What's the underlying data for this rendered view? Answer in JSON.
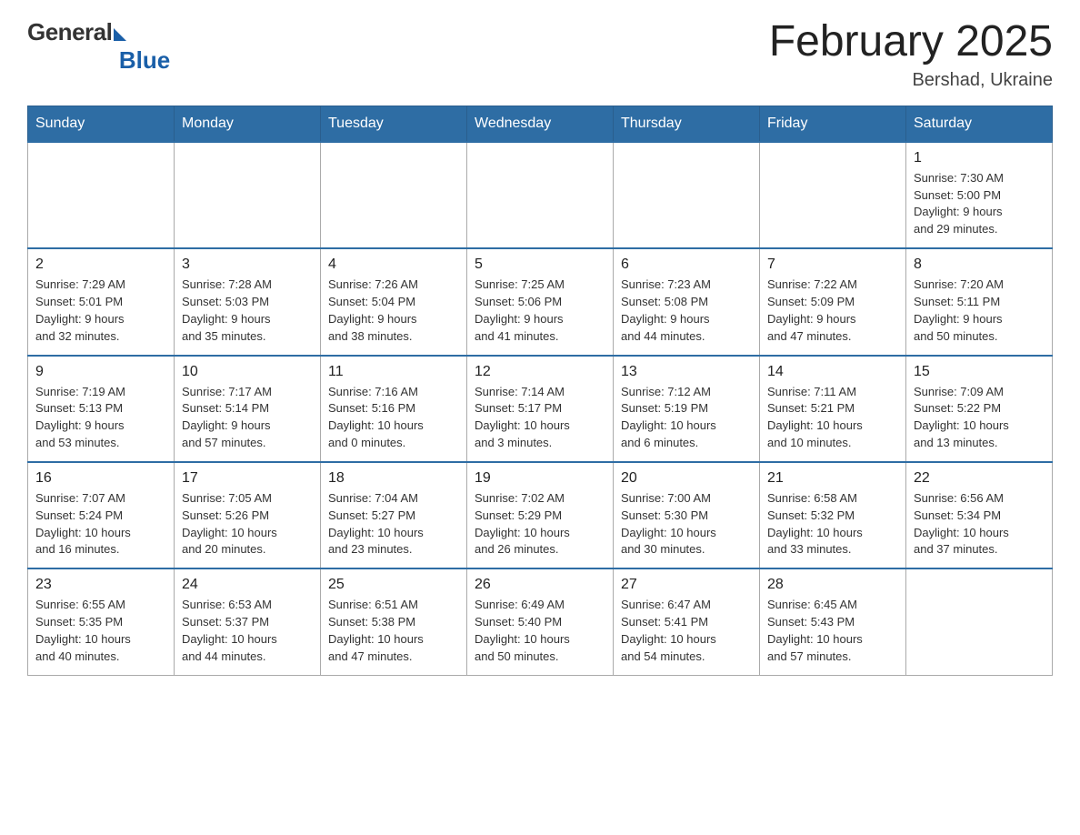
{
  "logo": {
    "general": "General",
    "blue": "Blue"
  },
  "header": {
    "title": "February 2025",
    "location": "Bershad, Ukraine"
  },
  "days_of_week": [
    "Sunday",
    "Monday",
    "Tuesday",
    "Wednesday",
    "Thursday",
    "Friday",
    "Saturday"
  ],
  "weeks": [
    {
      "days": [
        {
          "num": "",
          "info": ""
        },
        {
          "num": "",
          "info": ""
        },
        {
          "num": "",
          "info": ""
        },
        {
          "num": "",
          "info": ""
        },
        {
          "num": "",
          "info": ""
        },
        {
          "num": "",
          "info": ""
        },
        {
          "num": "1",
          "info": "Sunrise: 7:30 AM\nSunset: 5:00 PM\nDaylight: 9 hours\nand 29 minutes."
        }
      ]
    },
    {
      "days": [
        {
          "num": "2",
          "info": "Sunrise: 7:29 AM\nSunset: 5:01 PM\nDaylight: 9 hours\nand 32 minutes."
        },
        {
          "num": "3",
          "info": "Sunrise: 7:28 AM\nSunset: 5:03 PM\nDaylight: 9 hours\nand 35 minutes."
        },
        {
          "num": "4",
          "info": "Sunrise: 7:26 AM\nSunset: 5:04 PM\nDaylight: 9 hours\nand 38 minutes."
        },
        {
          "num": "5",
          "info": "Sunrise: 7:25 AM\nSunset: 5:06 PM\nDaylight: 9 hours\nand 41 minutes."
        },
        {
          "num": "6",
          "info": "Sunrise: 7:23 AM\nSunset: 5:08 PM\nDaylight: 9 hours\nand 44 minutes."
        },
        {
          "num": "7",
          "info": "Sunrise: 7:22 AM\nSunset: 5:09 PM\nDaylight: 9 hours\nand 47 minutes."
        },
        {
          "num": "8",
          "info": "Sunrise: 7:20 AM\nSunset: 5:11 PM\nDaylight: 9 hours\nand 50 minutes."
        }
      ]
    },
    {
      "days": [
        {
          "num": "9",
          "info": "Sunrise: 7:19 AM\nSunset: 5:13 PM\nDaylight: 9 hours\nand 53 minutes."
        },
        {
          "num": "10",
          "info": "Sunrise: 7:17 AM\nSunset: 5:14 PM\nDaylight: 9 hours\nand 57 minutes."
        },
        {
          "num": "11",
          "info": "Sunrise: 7:16 AM\nSunset: 5:16 PM\nDaylight: 10 hours\nand 0 minutes."
        },
        {
          "num": "12",
          "info": "Sunrise: 7:14 AM\nSunset: 5:17 PM\nDaylight: 10 hours\nand 3 minutes."
        },
        {
          "num": "13",
          "info": "Sunrise: 7:12 AM\nSunset: 5:19 PM\nDaylight: 10 hours\nand 6 minutes."
        },
        {
          "num": "14",
          "info": "Sunrise: 7:11 AM\nSunset: 5:21 PM\nDaylight: 10 hours\nand 10 minutes."
        },
        {
          "num": "15",
          "info": "Sunrise: 7:09 AM\nSunset: 5:22 PM\nDaylight: 10 hours\nand 13 minutes."
        }
      ]
    },
    {
      "days": [
        {
          "num": "16",
          "info": "Sunrise: 7:07 AM\nSunset: 5:24 PM\nDaylight: 10 hours\nand 16 minutes."
        },
        {
          "num": "17",
          "info": "Sunrise: 7:05 AM\nSunset: 5:26 PM\nDaylight: 10 hours\nand 20 minutes."
        },
        {
          "num": "18",
          "info": "Sunrise: 7:04 AM\nSunset: 5:27 PM\nDaylight: 10 hours\nand 23 minutes."
        },
        {
          "num": "19",
          "info": "Sunrise: 7:02 AM\nSunset: 5:29 PM\nDaylight: 10 hours\nand 26 minutes."
        },
        {
          "num": "20",
          "info": "Sunrise: 7:00 AM\nSunset: 5:30 PM\nDaylight: 10 hours\nand 30 minutes."
        },
        {
          "num": "21",
          "info": "Sunrise: 6:58 AM\nSunset: 5:32 PM\nDaylight: 10 hours\nand 33 minutes."
        },
        {
          "num": "22",
          "info": "Sunrise: 6:56 AM\nSunset: 5:34 PM\nDaylight: 10 hours\nand 37 minutes."
        }
      ]
    },
    {
      "days": [
        {
          "num": "23",
          "info": "Sunrise: 6:55 AM\nSunset: 5:35 PM\nDaylight: 10 hours\nand 40 minutes."
        },
        {
          "num": "24",
          "info": "Sunrise: 6:53 AM\nSunset: 5:37 PM\nDaylight: 10 hours\nand 44 minutes."
        },
        {
          "num": "25",
          "info": "Sunrise: 6:51 AM\nSunset: 5:38 PM\nDaylight: 10 hours\nand 47 minutes."
        },
        {
          "num": "26",
          "info": "Sunrise: 6:49 AM\nSunset: 5:40 PM\nDaylight: 10 hours\nand 50 minutes."
        },
        {
          "num": "27",
          "info": "Sunrise: 6:47 AM\nSunset: 5:41 PM\nDaylight: 10 hours\nand 54 minutes."
        },
        {
          "num": "28",
          "info": "Sunrise: 6:45 AM\nSunset: 5:43 PM\nDaylight: 10 hours\nand 57 minutes."
        },
        {
          "num": "",
          "info": ""
        }
      ]
    }
  ]
}
